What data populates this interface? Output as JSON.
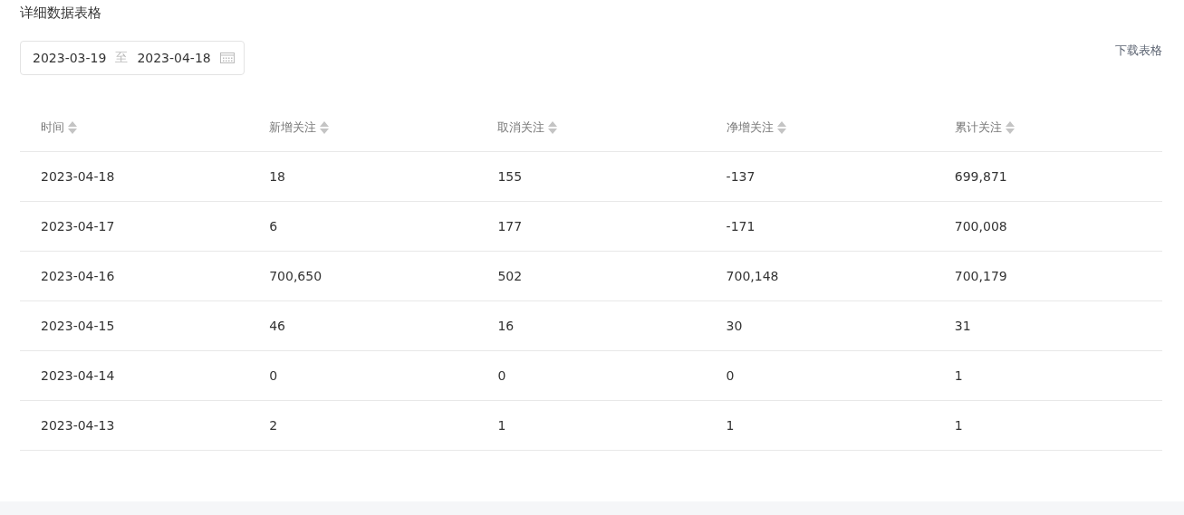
{
  "title": "详细数据表格",
  "date_range": {
    "start": "2023-03-19",
    "separator": "至",
    "end": "2023-04-18"
  },
  "download_link": "下载表格",
  "table": {
    "columns": [
      "时间",
      "新增关注",
      "取消关注",
      "净增关注",
      "累计关注"
    ],
    "rows": [
      [
        "2023-04-18",
        "18",
        "155",
        "-137",
        "699,871"
      ],
      [
        "2023-04-17",
        "6",
        "177",
        "-171",
        "700,008"
      ],
      [
        "2023-04-16",
        "700,650",
        "502",
        "700,148",
        "700,179"
      ],
      [
        "2023-04-15",
        "46",
        "16",
        "30",
        "31"
      ],
      [
        "2023-04-14",
        "0",
        "0",
        "0",
        "1"
      ],
      [
        "2023-04-13",
        "2",
        "1",
        "1",
        "1"
      ]
    ]
  }
}
